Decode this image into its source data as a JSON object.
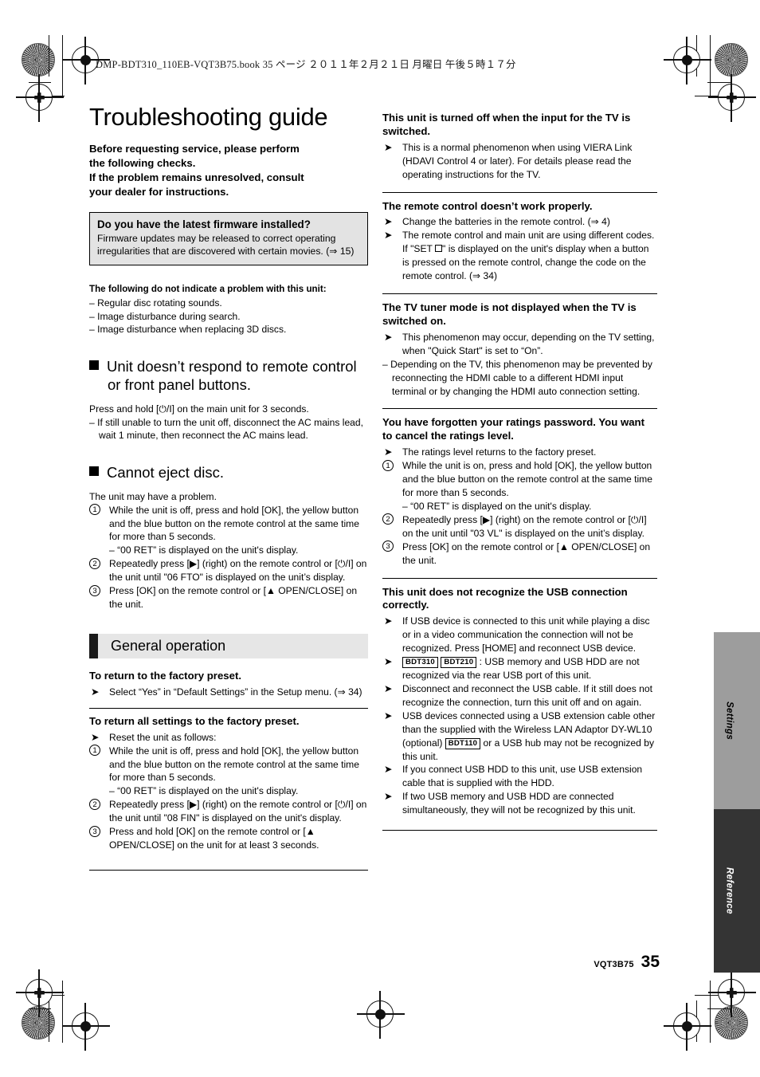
{
  "slug": "DMP-BDT310_110EB-VQT3B75.book   35 ページ   ２０１１年２月２１日   月曜日   午後５時１７分",
  "left": {
    "title": "Troubleshooting guide",
    "lead": [
      "Before requesting service, please perform",
      "the following checks.",
      "If the problem remains unresolved, consult",
      "your dealer for instructions."
    ],
    "firmware_box": {
      "title": "Do you have the latest firmware installed?",
      "body": "Firmware updates may be released to correct operating irregularities that are discovered with certain movies. (⇒ 15)"
    },
    "no_problem": {
      "heading": "The following do not indicate a problem with this unit:",
      "items": [
        "– Regular disc rotating sounds.",
        "– Image disturbance during search.",
        "– Image disturbance when replacing 3D discs."
      ]
    },
    "section_remote": {
      "heading": "Unit doesn’t respond to remote control or front panel buttons.",
      "line1": "Press and hold [⏻/I] on the main unit for 3 seconds.",
      "line2": "– If still unable to turn the unit off, disconnect the AC mains lead, wait 1 minute, then reconnect the AC mains lead."
    },
    "section_eject": {
      "heading": "Cannot eject disc.",
      "intro": "The unit may have a problem.",
      "step1": "While the unit is off, press and hold [OK], the yellow button and the blue button on the remote control at the same time for more than 5 seconds.",
      "step1_sub": "– “00 RET” is displayed on the unit's display.",
      "step2": "Repeatedly press [▶] (right) on the remote control or [⏻/I] on the unit until \"06 FTO\" is displayed on the unit’s display.",
      "step3": "Press [OK] on the remote control or [▲ OPEN/CLOSE] on the unit."
    },
    "general_operation": {
      "bar_label": "General operation",
      "q1": {
        "heading": "To return to the factory preset.",
        "bullet": "Select “Yes” in “Default Settings” in the Setup menu. (⇒ 34)"
      },
      "q2": {
        "heading": "To return all settings to the factory preset.",
        "bullet": "Reset the unit as follows:",
        "step1": "While the unit is off, press and hold [OK], the yellow button and the blue button on the remote control at the same time for more than 5 seconds.",
        "step1_sub": "– “00 RET” is displayed on the unit's display.",
        "step2": "Repeatedly press [▶] (right) on the remote control or [⏻/I] on the unit until \"08 FIN\" is displayed on the unit's display.",
        "step3": "Press and hold [OK] on the remote control or [▲ OPEN/CLOSE] on the unit for at least 3 seconds."
      }
    }
  },
  "right": {
    "q_tv_input": {
      "heading": "This unit is turned off when the input for the TV is switched.",
      "bullet": "This is a normal phenomenon when using VIERA Link (HDAVI Control 4 or later). For details please read the operating instructions for the TV."
    },
    "q_remote": {
      "heading": "The remote control doesn’t work properly.",
      "bullet1": "Change the batteries in the remote control. (⇒ 4)",
      "bullet2a": "The remote control and main unit are using different codes. If \"SET ",
      "bullet2b": "\" is displayed on the unit's display when a button is pressed on the remote control, change the code on the remote control. (⇒ 34)"
    },
    "q_tuner": {
      "heading": "The TV tuner mode is not displayed when the TV is switched on.",
      "bullet": "This phenomenon may occur, depending on the TV setting, when \"Quick Start\" is set to “On”.",
      "dash": "– Depending on the TV, this phenomenon may be prevented by reconnecting the HDMI cable to a different HDMI input terminal or by changing the HDMI auto connection setting."
    },
    "q_ratings": {
      "heading": "You have forgotten your ratings password. You want to cancel the ratings level.",
      "bullet": "The ratings level returns to the factory preset.",
      "step1": "While the unit is on, press and hold [OK], the yellow button and the blue button on the remote control at the same time for more than 5 seconds.",
      "step1_sub": "– “00 RET” is displayed on the unit's display.",
      "step2": "Repeatedly press [▶] (right) on the remote control or [⏻/I] on the unit until \"03 VL\" is displayed on the unit’s display.",
      "step3": "Press [OK] on the remote control or [▲ OPEN/CLOSE] on the unit."
    },
    "q_usb": {
      "heading": "This unit does not recognize the USB connection correctly.",
      "bullet1": "If USB device is connected to this unit while playing a disc or in a video communication the connection will not be recognized. Press [HOME] and reconnect USB device.",
      "bullet2_badge1": "BDT310",
      "bullet2_badge2": "BDT210",
      "bullet2_text": ": USB memory and USB HDD are not recognized via the rear USB port of this unit.",
      "bullet3": "Disconnect and reconnect the USB cable. If it still does not recognize the connection, turn this unit off and on again.",
      "bullet4a": "USB devices connected using a USB extension cable other than the supplied with the Wireless LAN Adaptor DY-WL10 (optional) ",
      "bullet4_badge": "BDT110",
      "bullet4b": " or a USB hub may not be recognized by this unit.",
      "bullet5": "If you connect USB HDD to this unit, use USB extension cable that is supplied with the HDD.",
      "bullet6": "If two USB memory and USB HDD are connected simultaneously, they will not be recognized by this unit."
    }
  },
  "side_tabs": [
    {
      "label": "Settings",
      "color": "#9d9d9d"
    },
    {
      "label": "Reference",
      "color": "#343434"
    }
  ],
  "footer": {
    "code": "VQT3B75",
    "page_number": "35"
  }
}
